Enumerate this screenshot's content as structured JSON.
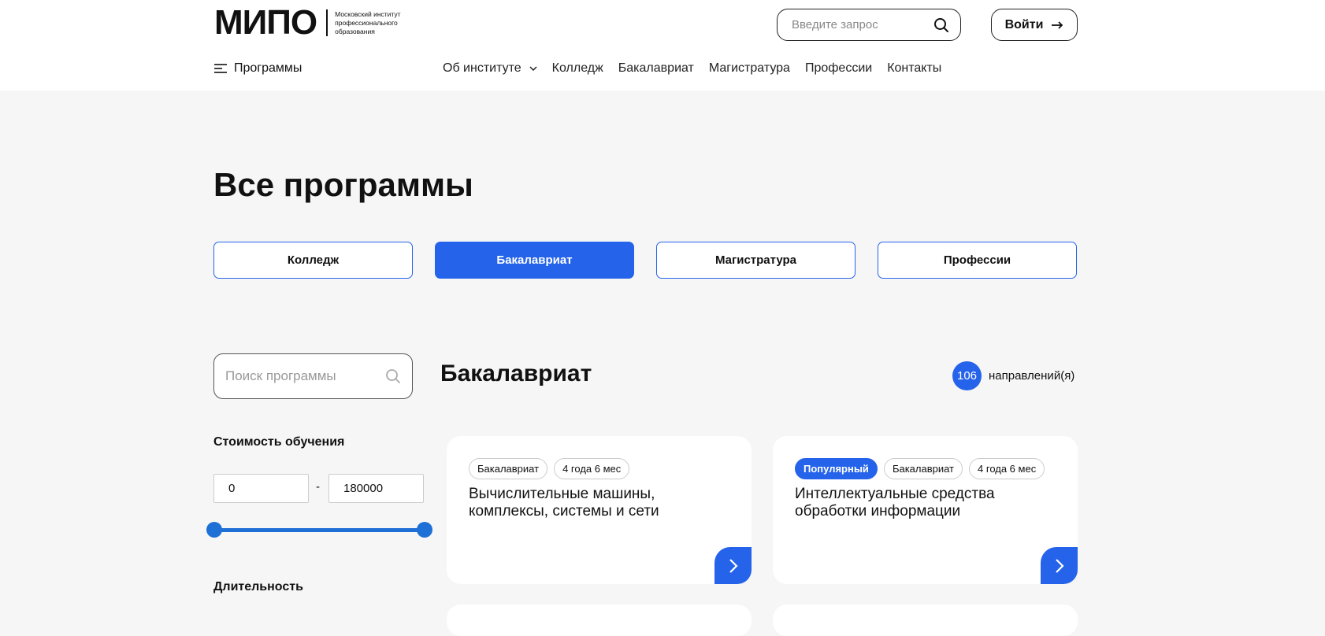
{
  "header": {
    "logo_mark": "МИПО",
    "logo_text": "Московский институт профессионального образования",
    "search_placeholder": "Введите запрос",
    "login_label": "Войти",
    "programs_label": "Программы",
    "nav": [
      {
        "label": "Об институте"
      },
      {
        "label": "Колледж"
      },
      {
        "label": "Бакалавриат"
      },
      {
        "label": "Магистратура"
      },
      {
        "label": "Профессии"
      },
      {
        "label": "Контакты"
      }
    ]
  },
  "page": {
    "title": "Все программы",
    "tabs": [
      {
        "label": "Колледж"
      },
      {
        "label": "Бакалавриат"
      },
      {
        "label": "Магистратура"
      },
      {
        "label": "Профессии"
      }
    ],
    "active_tab": "Бакалавриат"
  },
  "filters": {
    "search_placeholder": "Поиск программы",
    "cost_title": "Стоимость обучения",
    "price_from": "0",
    "price_to": "180000",
    "price_separator": "-",
    "duration_title": "Длительность"
  },
  "results": {
    "title": "Бакалавриат",
    "count": "106",
    "count_label": "направлений(я)"
  },
  "cards": [
    {
      "tags": [
        "Бакалавриат",
        "4 года 6 мес"
      ],
      "popular": null,
      "title": "Вычислительные машины, комплексы, системы и сети"
    },
    {
      "tags": [
        "Бакалавриат",
        "4 года 6 мес"
      ],
      "popular": "Популярный",
      "title": "Интеллектуальные средства обработки информации"
    }
  ],
  "colors": {
    "accent": "#2563eb",
    "slider": "#1e6fd6",
    "background": "#f6f6f6"
  }
}
